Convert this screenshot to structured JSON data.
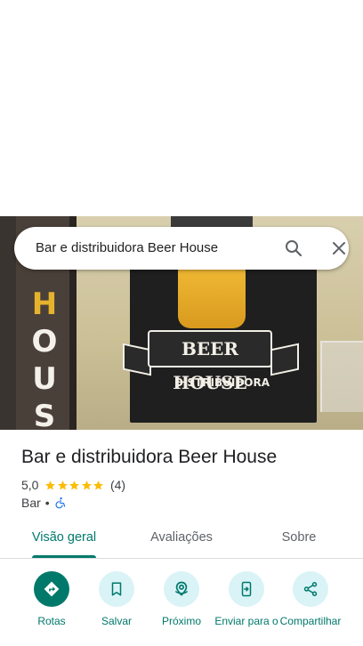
{
  "search": {
    "query": "Bar e distribuidora Beer House"
  },
  "hero": {
    "sign_letters": [
      "H",
      "O",
      "U",
      "S"
    ],
    "banner_text": "BEER HOUSE",
    "sub_text": "DISTRIBUIDORA"
  },
  "place": {
    "name": "Bar e distribuidora Beer House",
    "rating": "5,0",
    "stars": 5,
    "review_count": "(4)",
    "category": "Bar",
    "separator": "•"
  },
  "tabs": [
    {
      "label": "Visão geral",
      "active": true
    },
    {
      "label": "Avaliações",
      "active": false
    },
    {
      "label": "Sobre",
      "active": false
    }
  ],
  "actions": [
    {
      "label": "Rotas",
      "icon": "directions-icon",
      "primary": true
    },
    {
      "label": "Salvar",
      "icon": "bookmark-icon",
      "primary": false
    },
    {
      "label": "Próximo",
      "icon": "nearby-icon",
      "primary": false
    },
    {
      "label": "Enviar para o",
      "icon": "send-to-phone-icon",
      "primary": false
    },
    {
      "label": "Compartilhar",
      "icon": "share-icon",
      "primary": false
    }
  ],
  "colors": {
    "accent": "#00796b",
    "star": "#fbbc04",
    "accessibility": "#1a73e8",
    "action_bg": "#d9f3f7"
  }
}
